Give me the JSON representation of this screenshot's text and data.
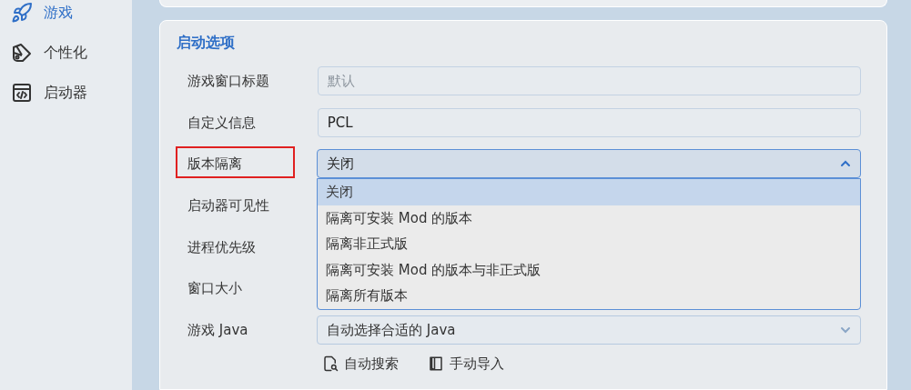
{
  "sidebar": {
    "items": [
      {
        "label": "游戏",
        "selected": true
      },
      {
        "label": "个性化",
        "selected": false
      },
      {
        "label": "启动器",
        "selected": false
      }
    ]
  },
  "launch_options": {
    "title": "启动选项",
    "rows": [
      {
        "label": "游戏窗口标题",
        "kind": "text",
        "placeholder": "默认",
        "highlighted": false
      },
      {
        "label": "自定义信息",
        "kind": "text",
        "value": "PCL",
        "highlighted": false
      },
      {
        "label": "版本隔离",
        "kind": "select",
        "value": "关闭",
        "expanded": true,
        "highlighted": true,
        "options": [
          {
            "label": "关闭",
            "selected": true
          },
          {
            "label": "隔离可安装 Mod 的版本",
            "selected": false
          },
          {
            "label": "隔离非正式版",
            "selected": false
          },
          {
            "label": "隔离可安装 Mod 的版本与非正式版",
            "selected": false
          },
          {
            "label": "隔离所有版本",
            "selected": false
          }
        ]
      },
      {
        "label": "启动器可见性",
        "kind": "covered",
        "highlighted": false
      },
      {
        "label": "进程优先级",
        "kind": "covered",
        "highlighted": false
      },
      {
        "label": "窗口大小",
        "kind": "covered",
        "highlighted": false
      },
      {
        "label": "游戏 Java",
        "kind": "select",
        "value": "自动选择合适的 Java",
        "expanded": false,
        "highlighted": false
      }
    ],
    "actions": [
      {
        "label": "自动搜索"
      },
      {
        "label": "手动导入"
      }
    ]
  }
}
